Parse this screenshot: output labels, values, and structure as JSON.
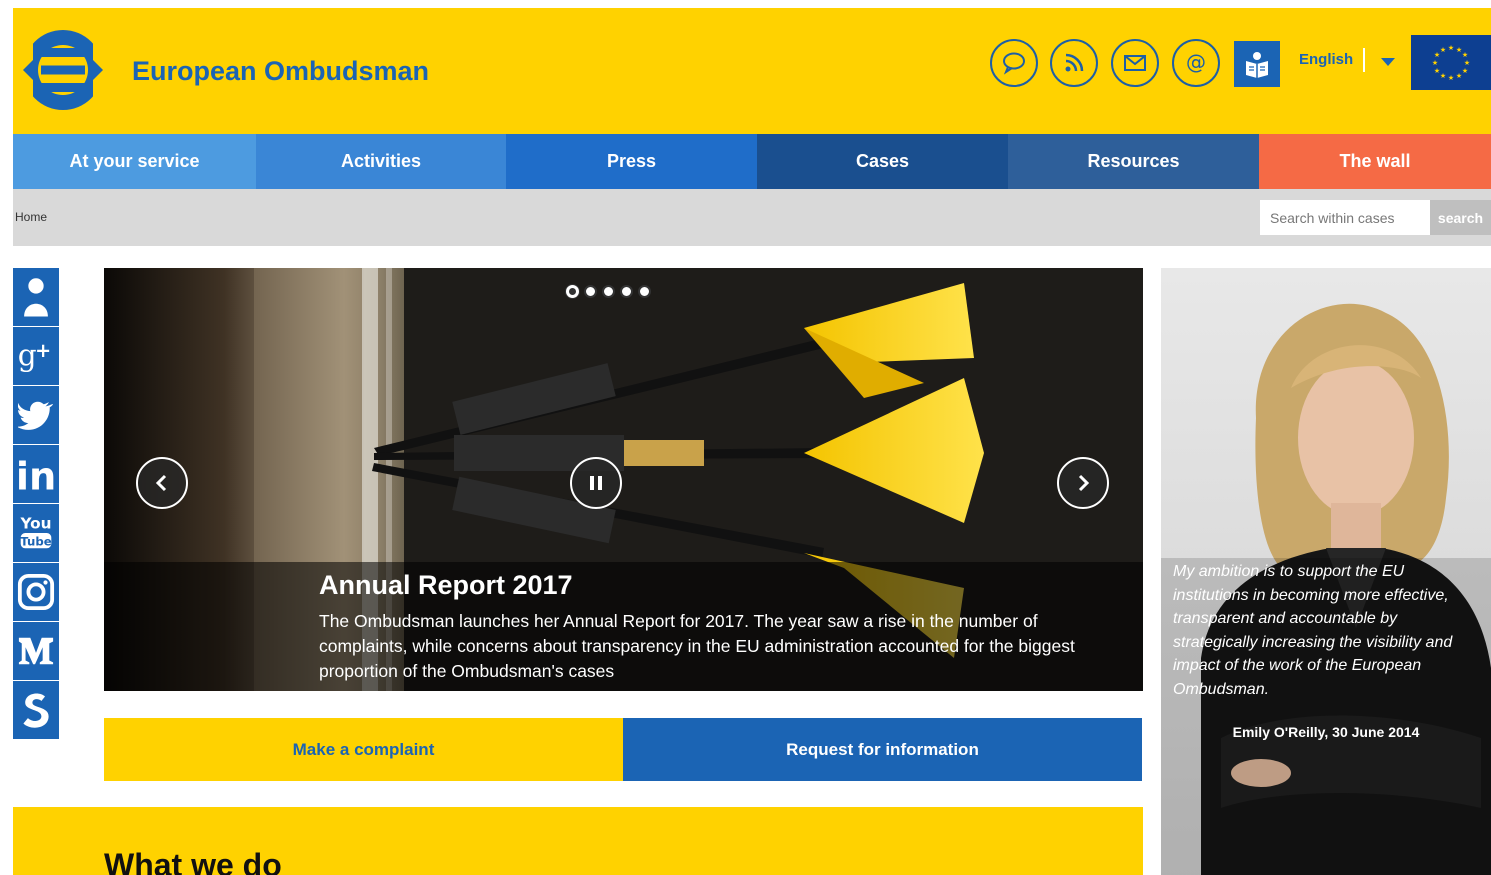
{
  "header": {
    "title": "European Ombudsman",
    "icons": [
      {
        "name": "chat-icon"
      },
      {
        "name": "rss-icon"
      },
      {
        "name": "mail-icon"
      },
      {
        "name": "at-icon"
      }
    ],
    "easy_read_icon": "easy-read-icon",
    "language": "English",
    "colors": {
      "yellow": "#ffd200",
      "blue": "#1b64b4"
    }
  },
  "nav": {
    "items": [
      {
        "label": "At your service",
        "color": "#4d9be0"
      },
      {
        "label": "Activities",
        "color": "#3a86d6"
      },
      {
        "label": "Press",
        "color": "#1f6dc9"
      },
      {
        "label": "Cases",
        "color": "#1a4f8f"
      },
      {
        "label": "Resources",
        "color": "#2e5f9a"
      },
      {
        "label": "The wall",
        "color": "#f56a45"
      }
    ]
  },
  "breadcrumb": {
    "home": "Home"
  },
  "search": {
    "placeholder": "Search within cases",
    "button": "search"
  },
  "social": [
    {
      "name": "profile-icon",
      "glyph": "♟"
    },
    {
      "name": "google-plus-icon",
      "glyph": "g+"
    },
    {
      "name": "twitter-icon",
      "glyph": "🐦"
    },
    {
      "name": "linkedin-icon",
      "glyph": "in"
    },
    {
      "name": "youtube-icon",
      "glyph": "You Tube"
    },
    {
      "name": "instagram-icon",
      "glyph": "◎"
    },
    {
      "name": "medium-icon",
      "glyph": "M"
    },
    {
      "name": "scribd-icon",
      "glyph": "S"
    }
  ],
  "slider": {
    "title": "Annual Report 2017",
    "text": "The Ombudsman launches her Annual Report for 2017. The year saw a rise in the number of complaints, while concerns about transparency in the EU administration accounted for the biggest proportion of the Ombudsman's cases",
    "slide_count": 5,
    "active_slide": 1
  },
  "cta": {
    "complaint": "Make a complaint",
    "information": "Request for information"
  },
  "what_we_do": {
    "title": "What we do"
  },
  "quote": {
    "text": "My ambition is to support the EU institutions in becoming more effective, transparent and accountable by strategically increasing the visibility and impact of the work of the European Ombudsman.",
    "signature": "Emily O'Reilly, 30 June 2014"
  }
}
